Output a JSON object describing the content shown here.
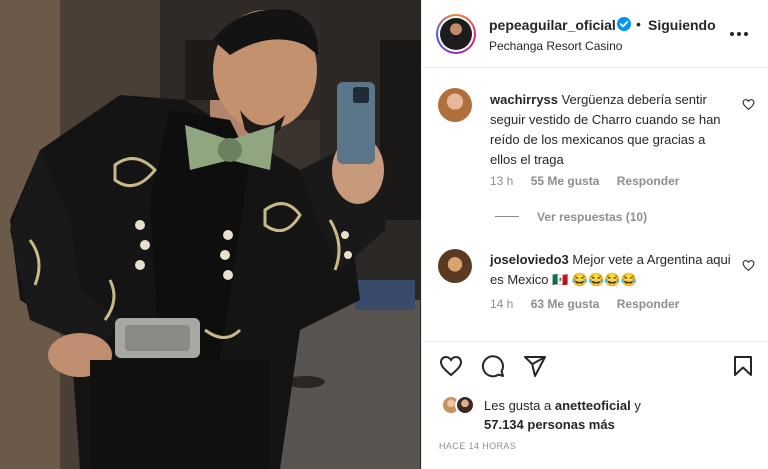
{
  "post": {
    "username": "pepeaguilar_oficial",
    "follow_status": "Siguiendo",
    "separator": "•",
    "location": "Pechanga Resort Casino",
    "verified_icon": "verified-badge-icon",
    "more_icon": "more-options-icon"
  },
  "comments": [
    {
      "username": "wachirryss",
      "text": "Vergüenza debería sentir seguir vestido de Charro cuando se han reído de los mexicanos que gracias a ellos el traga",
      "time": "13 h",
      "likes": "55 Me gusta",
      "reply": "Responder"
    },
    {
      "username": "joseloviedo3",
      "text": "Mejor vete a Argentina aqui es Mexico 🇲🇽 😂😂😂😂",
      "time": "14 h",
      "likes": "63 Me gusta",
      "reply": "Responder"
    }
  ],
  "view_replies": "Ver respuestas (10)",
  "likes": {
    "prefix": "Les gusta a",
    "user": "anetteoficial",
    "joiner": "y",
    "count": "57.134 personas más"
  },
  "timestamp": "HACE 14 HORAS",
  "colors": {
    "verified": "#0095f6",
    "muted": "#8e8e8e",
    "text": "#262626"
  }
}
